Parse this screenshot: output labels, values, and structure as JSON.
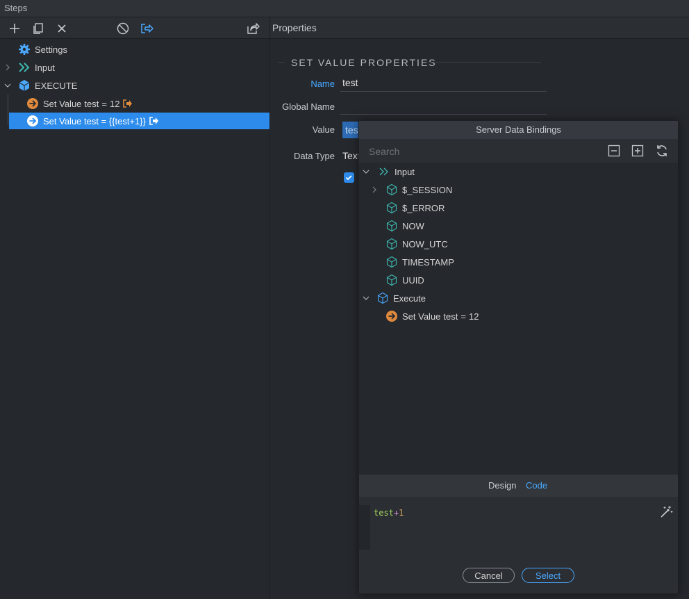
{
  "window": {
    "title": "Steps"
  },
  "toolbar": {
    "properties_label": "Properties"
  },
  "steps": {
    "settings": "Settings",
    "input": "Input",
    "execute": "EXECUTE",
    "step1": {
      "label": "Set Value",
      "var": "test",
      "op": "=",
      "value": "12"
    },
    "step2": {
      "label": "Set Value test = {{test+1}}"
    }
  },
  "properties": {
    "section_title": "SET VALUE PROPERTIES",
    "name_label": "Name",
    "name_value": "test",
    "global_name_label": "Global Name",
    "value_label": "Value",
    "value_value": "tes",
    "data_type_label": "Data Type",
    "data_type_value": "Text"
  },
  "dialog": {
    "title": "Server Data Bindings",
    "search_placeholder": "Search",
    "tree": {
      "input": "Input",
      "items": [
        "$_SESSION",
        "$_ERROR",
        "NOW",
        "NOW_UTC",
        "TIMESTAMP",
        "UUID"
      ],
      "execute": "Execute",
      "step": {
        "label": "Set Value",
        "var": "test",
        "op": "=",
        "value": "12"
      }
    },
    "tabs": {
      "design": "Design",
      "code": "Code"
    },
    "code": {
      "var": "test",
      "op": "+",
      "num": "1"
    },
    "buttons": {
      "cancel": "Cancel",
      "select": "Select"
    }
  },
  "colors": {
    "accent": "#2d8ceb",
    "link": "#4aa8ff",
    "green": "#9ed36a",
    "orange": "#e08a3c",
    "teal": "#3fb9b0"
  }
}
